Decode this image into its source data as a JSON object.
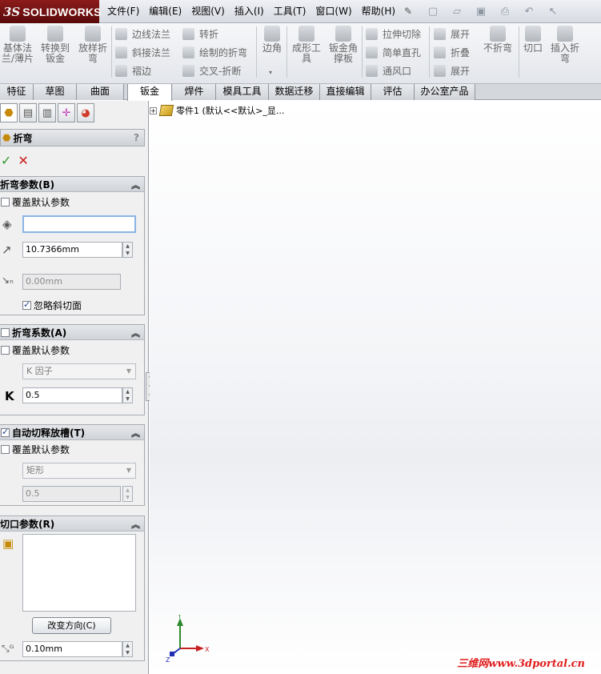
{
  "app": {
    "brand_ds": "3S",
    "brand_name": "SOLIDWORKS"
  },
  "menus": [
    "文件(F)",
    "编辑(E)",
    "视图(V)",
    "插入(I)",
    "工具(T)",
    "窗口(W)",
    "帮助(H)"
  ],
  "command_manager": {
    "big": [
      {
        "id": "base_flange",
        "label": "基体法\n兰/薄片"
      },
      {
        "id": "convert",
        "label": "转换到\n钣金"
      },
      {
        "id": "lofted_bend",
        "label": "放样折\n弯"
      },
      {
        "id": "corner",
        "label": "边角"
      },
      {
        "id": "forming_tool",
        "label": "成形工\n具"
      },
      {
        "id": "gusset",
        "label": "钣金角\n撑板"
      },
      {
        "id": "no_bends",
        "label": "不折弯"
      },
      {
        "id": "rip",
        "label": "切口"
      },
      {
        "id": "insert_bends",
        "label": "插入折\n弯"
      }
    ],
    "small": [
      {
        "id": "edge_flange",
        "label": "边线法兰"
      },
      {
        "id": "miter_flange",
        "label": "斜接法兰"
      },
      {
        "id": "hem",
        "label": "褶边"
      },
      {
        "id": "jog",
        "label": "转折"
      },
      {
        "id": "sketched_bend",
        "label": "绘制的折弯"
      },
      {
        "id": "cross_break",
        "label": "交叉-折断"
      },
      {
        "id": "extruded_cut",
        "label": "拉伸切除"
      },
      {
        "id": "simple_hole",
        "label": "简单直孔"
      },
      {
        "id": "vent",
        "label": "通风口"
      },
      {
        "id": "unfold",
        "label": "展开"
      },
      {
        "id": "fold",
        "label": "折叠"
      },
      {
        "id": "flatten",
        "label": "展开"
      }
    ]
  },
  "tabs": [
    "特征",
    "草图",
    "曲面",
    "钣金",
    "焊件",
    "模具工具",
    "数据迁移",
    "直接编辑",
    "评估",
    "办公室产品"
  ],
  "active_tab": "钣金",
  "property_manager": {
    "title": "折弯",
    "help": "?",
    "bend_params": {
      "header": "折弯参数(B)",
      "override_label": "覆盖默认参数",
      "radius_value": "10.7366mm",
      "thickness_value": "0.00mm",
      "ignore_bevel_label": "忽略斜切面"
    },
    "bend_allowance": {
      "header": "折弯系数(A)",
      "override_label": "覆盖默认参数",
      "type_value": "K 因子",
      "k_label": "K",
      "k_value": "0.5"
    },
    "auto_relief": {
      "header": "自动切释放槽(T)",
      "override_label": "覆盖默认参数",
      "type_value": "矩形",
      "ratio_value": "0.5"
    },
    "rip_params": {
      "header": "切口参数(R)",
      "change_direction_label": "改变方向(C)",
      "gap_value": "0.10mm"
    }
  },
  "feature_tree": {
    "item": "零件1  (默认<<默认>_显..."
  },
  "triad": {
    "x": "X",
    "y": "Y",
    "z": "Z"
  },
  "watermark": "三维网www.3dportal.cn"
}
